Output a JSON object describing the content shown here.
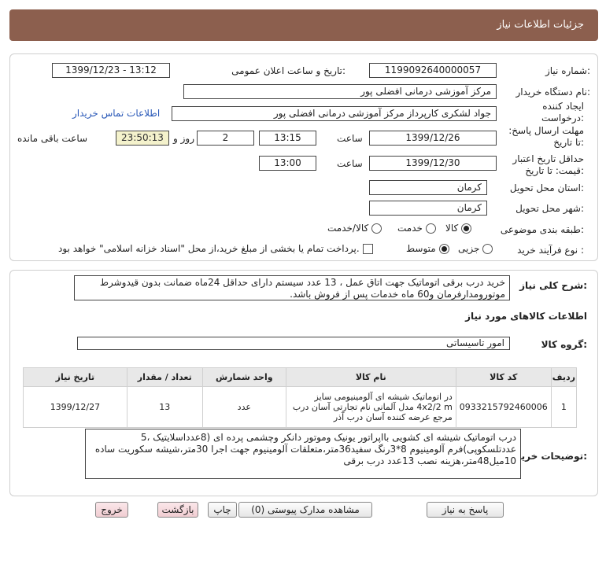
{
  "header": {
    "title": "جزئیات اطلاعات نیاز"
  },
  "fields": {
    "need_number_label": "شماره نیاز:",
    "need_number": "1199092640000057",
    "announce_label": "تاریخ و ساعت اعلان عمومی:",
    "announce_value": "1399/12/23 - 13:12",
    "buyer_label": "نام دستگاه خریدار:",
    "buyer_value": "مرکز آموزشی درمانی افضلی پور",
    "creator_label": "ایجاد کننده درخواست:",
    "creator_value": "جواد  لشکری  کارپرداز مرکز آموزشی درمانی افضلی پور",
    "contact_link": "اطلاعات تماس خریدار",
    "deadline_label": "مهلت ارسال پاسخ: تا تاریخ:",
    "deadline_date": "1399/12/26",
    "time_label": "ساعت",
    "deadline_time": "13:15",
    "days_value": "2",
    "days_label": "روز و",
    "remaining_time": "23:50:13",
    "remaining_label": "ساعت باقی مانده",
    "validity_label": "حداقل تاریخ اعتبار قیمت: تا تاریخ:",
    "validity_date": "1399/12/30",
    "validity_time_label": "ساعت",
    "validity_time": "13:00",
    "province_label": "استان محل تحویل:",
    "province_value": "کرمان",
    "city_label": "شهر محل تحویل:",
    "city_value": "کرمان",
    "category_label": "طبقه بندی موضوعی:",
    "category_options": [
      "کالا",
      "خدمت",
      "کالا/خدمت"
    ],
    "process_label": "نوع فرآیند خرید :",
    "process_options": [
      "جزیی",
      "متوسط"
    ],
    "payment_note": "پرداخت تمام یا بخشی از مبلغ خرید،از محل \"اسناد خزانه اسلامی\" خواهد بود."
  },
  "summary": {
    "label": "شرح کلی نیاز:",
    "text": "خرید درب برقی اتوماتیک جهت اتاق عمل ، 13 عدد سیستم دارای حداقل 24ماه ضمانت بدون قیدوشرط موتورومدارفرمان و60 ماه خدمات پس از فروش باشد."
  },
  "goods": {
    "section_title": "اطلاعات کالاهای مورد نیاز",
    "group_label": "گروه کالا:",
    "group_value": "امور تاسیساتی",
    "columns": [
      "ردیف",
      "کد کالا",
      "نام کالا",
      "واحد شمارش",
      "تعداد / مقدار",
      "تاریخ نیاز"
    ],
    "rows": [
      {
        "index": "1",
        "code": "0933215792460006",
        "name": "در اتوماتیک شیشه ای آلومینیومی سایز 4x2/2 m مدل آلمانی نام تجارتی آسان درب مرجع عرضه کننده آسان درب آذر",
        "unit": "عدد",
        "qty": "13",
        "date": "1399/12/27"
      }
    ]
  },
  "buyer_notes": {
    "label": "توضیحات خریدار:",
    "text": "درب اتوماتیک شیشه ای کشویی بااپراتور یونیک وموتور دانکر وچشمی پرده ای (8عدداسلایتیک ،5 عددتلسکوپی)فرم آلومینیوم 8*3رنگ سفید36متر،متعلقات آلومینیوم جهت اجرا 30متر،شیشه سکوریت ساده 10میل48متر،هزینه نصب 13عدد درب برقی"
  },
  "buttons": {
    "reply": "پاسخ به نیاز",
    "attachments": "مشاهده مدارک پیوستی (0)",
    "print": "چاپ",
    "back": "بازگشت",
    "exit": "خروج"
  },
  "colors": {
    "header": "#8c5f4e",
    "remaining_bg": "#f4f2cc",
    "link": "#2a59b8"
  }
}
